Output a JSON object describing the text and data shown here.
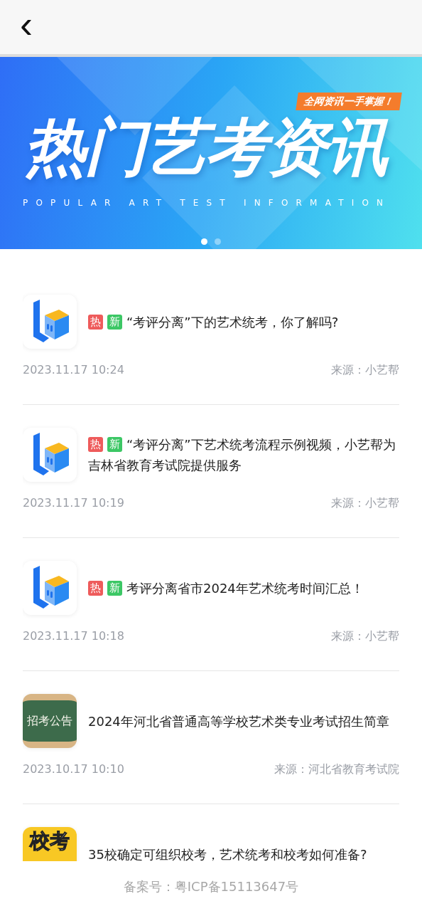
{
  "header": {
    "back_icon": "‹"
  },
  "banner": {
    "ribbon": "全网资讯一手掌握！",
    "title": "热门艺考资讯",
    "subtitle": "POPULAR ART TEST INFORMATION",
    "dots": [
      {
        "selected": true
      },
      {
        "selected": false
      }
    ]
  },
  "articles": [
    {
      "thumb": {
        "kind": "logo"
      },
      "hot": true,
      "new": true,
      "tags": {
        "hot": "热",
        "new": "新"
      },
      "title": "“考评分离”下的艺术统考，你了解吗?",
      "time": "2023.11.17 10:24",
      "source": "来源：小艺帮"
    },
    {
      "thumb": {
        "kind": "logo"
      },
      "hot": true,
      "new": true,
      "tags": {
        "hot": "热",
        "new": "新"
      },
      "title": "“考评分离”下艺术统考流程示例视频，小艺帮为吉林省教育考试院提供服务",
      "time": "2023.11.17 10:19",
      "source": "来源：小艺帮"
    },
    {
      "thumb": {
        "kind": "logo"
      },
      "hot": true,
      "new": true,
      "tags": {
        "hot": "热",
        "new": "新"
      },
      "title": "考评分离省市2024年艺术统考时间汇总！",
      "time": "2023.11.17 10:18",
      "source": "来源：小艺帮"
    },
    {
      "thumb": {
        "kind": "board",
        "text": "招考公告"
      },
      "hot": false,
      "new": false,
      "title": "2024年河北省普通高等学校艺术类专业考试招生简章",
      "time": "2023.10.17 10:10",
      "source": "来源：河北省教育考试院"
    },
    {
      "thumb": {
        "kind": "poster",
        "text": "校考"
      },
      "hot": false,
      "new": false,
      "title": "35校确定可组织校考，艺术统考和校考如何准备?"
    }
  ],
  "footer": {
    "text": "备案号：粤ICP备15113647号"
  }
}
